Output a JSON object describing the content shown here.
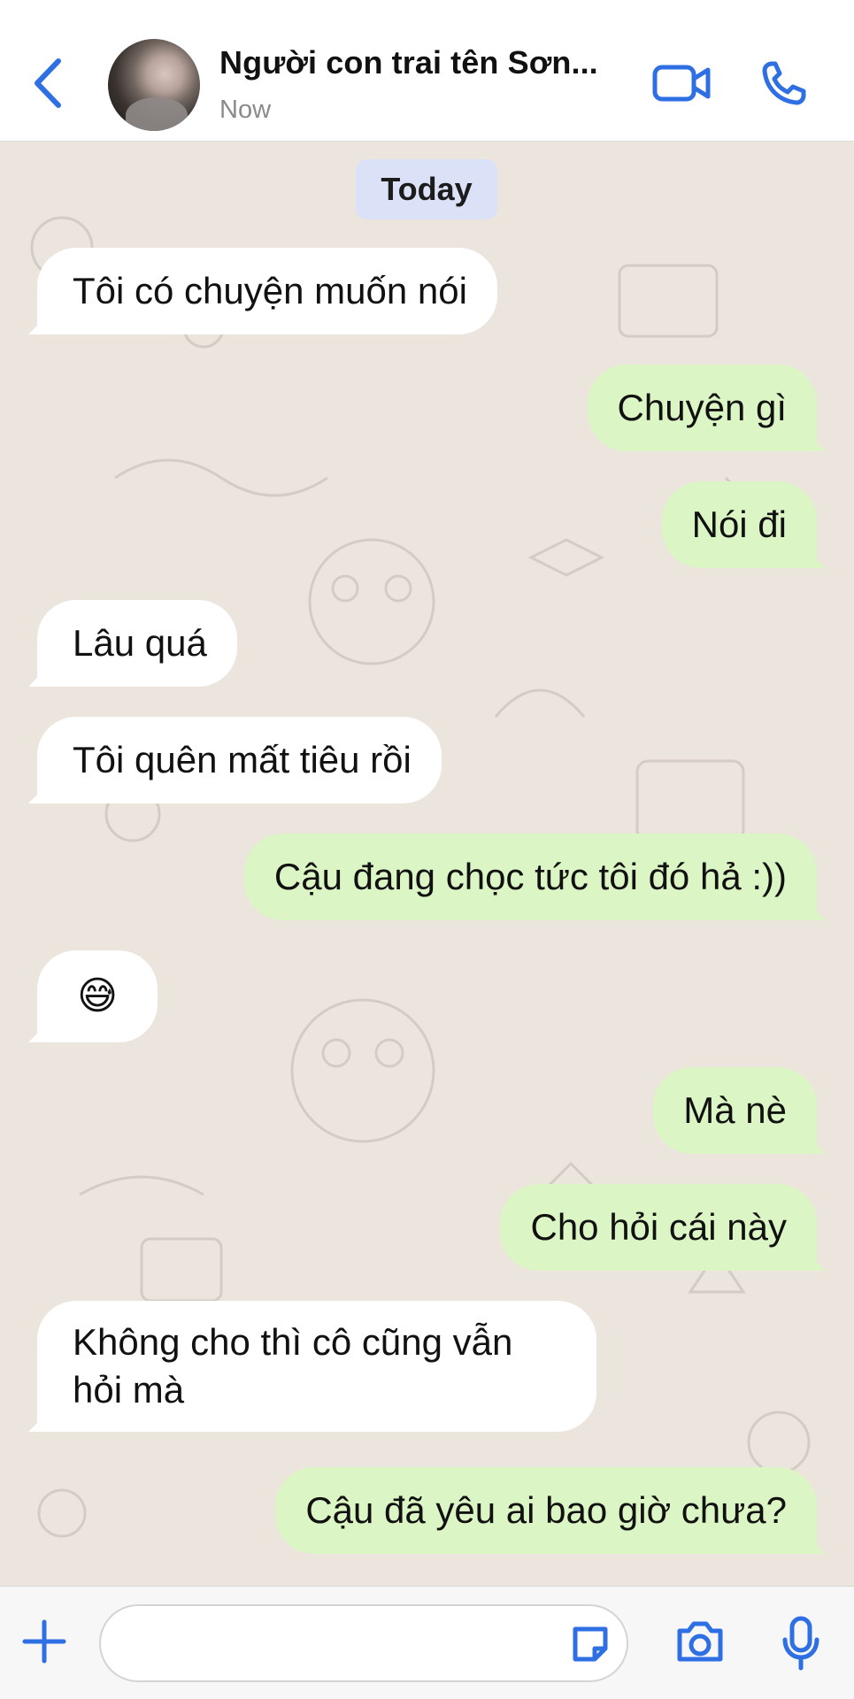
{
  "header": {
    "contact_name": "Người con trai tên Sơn...",
    "status": "Now"
  },
  "chat": {
    "date_label": "Today",
    "messages": [
      {
        "direction": "incoming",
        "text": "Tôi có chuyện muốn nói"
      },
      {
        "direction": "outgoing",
        "text": "Chuyện gì"
      },
      {
        "direction": "outgoing",
        "text": "Nói đi"
      },
      {
        "direction": "incoming",
        "text": "Lâu quá"
      },
      {
        "direction": "incoming",
        "text": "Tôi quên mất tiêu rồi"
      },
      {
        "direction": "outgoing",
        "text": "Cậu đang chọc tức tôi đó hả :))"
      },
      {
        "direction": "incoming",
        "text": "😅"
      },
      {
        "direction": "outgoing",
        "text": "Mà nè"
      },
      {
        "direction": "outgoing",
        "text": "Cho hỏi cái này"
      },
      {
        "direction": "incoming",
        "text": "Không cho thì cô cũng vẫn hỏi mà"
      },
      {
        "direction": "outgoing",
        "text": "Cậu đã yêu ai bao giờ chưa?"
      }
    ]
  },
  "colors": {
    "accent": "#2f6fe4",
    "incoming_bubble": "#ffffff",
    "outgoing_bubble": "#dcf5c4",
    "chat_background": "#ece5dd",
    "date_pill": "#dbe1f7"
  },
  "icons": {
    "back": "back-chevron-icon",
    "video": "video-call-icon",
    "phone": "phone-call-icon",
    "attach": "plus-icon",
    "sticker": "sticker-icon",
    "camera": "camera-icon",
    "microphone": "microphone-icon"
  },
  "composer": {
    "value": "",
    "placeholder": ""
  }
}
